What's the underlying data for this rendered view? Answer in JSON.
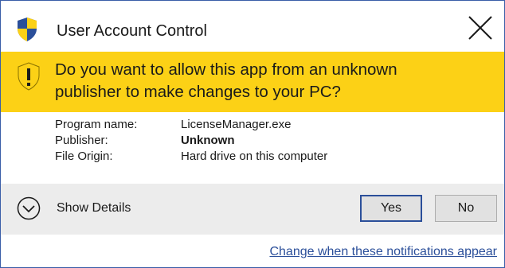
{
  "window": {
    "title": "User Account Control",
    "shield_icon": "uac-shield-icon",
    "close_icon": "close-icon"
  },
  "banner": {
    "question": "Do you want to allow this app from an unknown publisher to make changes to your PC?",
    "line1": "Do you want to allow this app from an unknown",
    "line2": "publisher to make changes to your PC?",
    "icon": "warning-shield-icon",
    "color": "#fcd116"
  },
  "info": {
    "program_label": "Program name:",
    "program_value": "LicenseManager.exe",
    "publisher_label": "Publisher:",
    "publisher_value": "Unknown",
    "origin_label": "File Origin:",
    "origin_value": "Hard drive on this computer"
  },
  "footer": {
    "details_label": "Show Details",
    "details_icon": "chevron-down-circle-icon",
    "yes_label": "Yes",
    "no_label": "No"
  },
  "link": {
    "text": "Change when these notifications appear"
  },
  "colors": {
    "accent": "#2b4f9a",
    "footer_bg": "#ececec"
  }
}
